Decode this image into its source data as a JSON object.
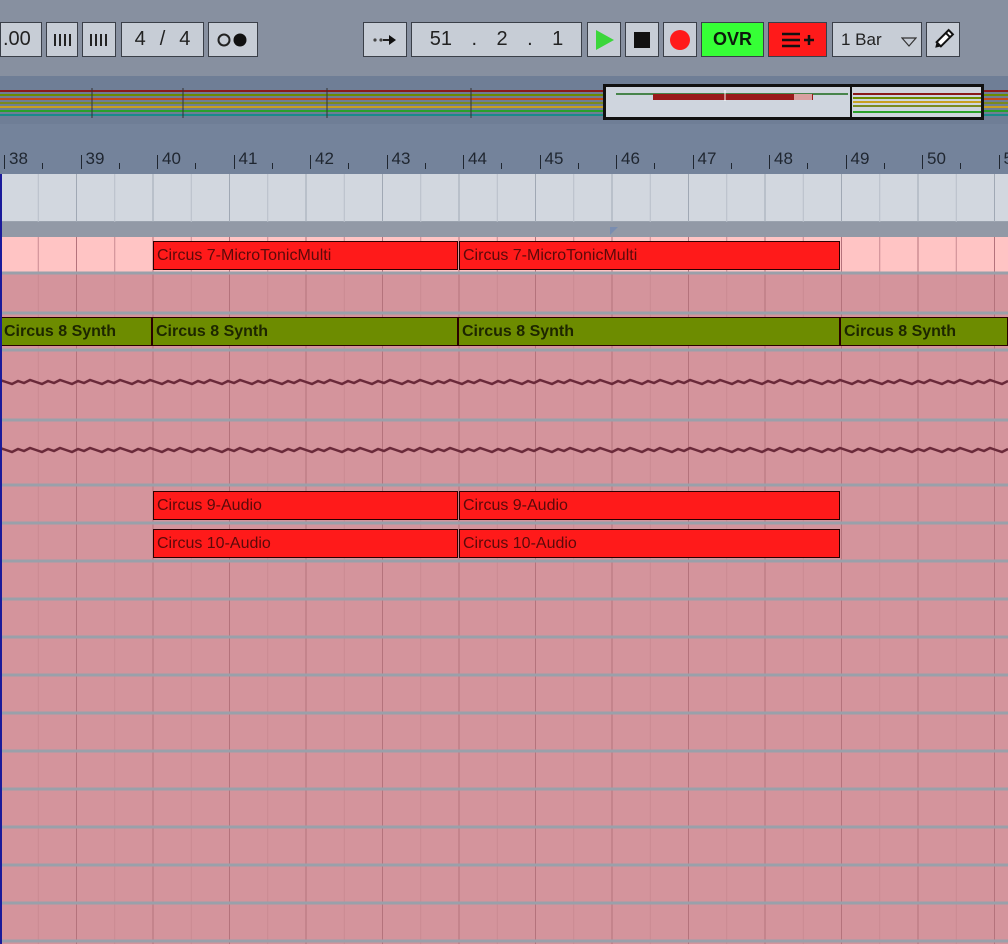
{
  "control_bar": {
    "tempo_fragment": ".00",
    "meter_numerator": "4",
    "meter_separator": "/",
    "meter_denominator": "4",
    "position": {
      "bar": "51",
      "beat": "2",
      "sixteenth": "1",
      "sep": "."
    },
    "ovr_label": "OVR",
    "quantize_label": "1 Bar"
  },
  "ruler": {
    "bars": [
      "38",
      "39",
      "40",
      "41",
      "42",
      "43",
      "44",
      "45",
      "46",
      "47",
      "48",
      "49",
      "50",
      "5"
    ]
  },
  "clips": [
    {
      "name": "Circus 7-MicroTonicMulti",
      "color": "red"
    },
    {
      "name": "Circus 7-MicroTonicMulti",
      "color": "red"
    },
    {
      "name": "Circus 8 Synth",
      "color": "olive"
    },
    {
      "name": "Circus 8 Synth",
      "color": "olive"
    },
    {
      "name": "Circus 8 Synth",
      "color": "olive"
    },
    {
      "name": "Circus 8 Synth",
      "color": "olive"
    },
    {
      "name": "Circus 9-Audio",
      "color": "red"
    },
    {
      "name": "Circus 9-Audio",
      "color": "red"
    },
    {
      "name": "Circus 10-Audio",
      "color": "red"
    },
    {
      "name": "Circus 10-Audio",
      "color": "red"
    }
  ],
  "colors": {
    "clip_red": "#ff1a1a",
    "clip_olive": "#6d8c00",
    "track_pink": "#d4949c",
    "play_green": "#3ad63a",
    "record_red": "#ff1a1a",
    "ovr_green": "#36ff36"
  },
  "icons": [
    "metronome-icon",
    "tap-icon",
    "follow-icon",
    "play-icon",
    "stop-icon",
    "record-icon",
    "session-record-icon",
    "draw-mode-icon"
  ]
}
